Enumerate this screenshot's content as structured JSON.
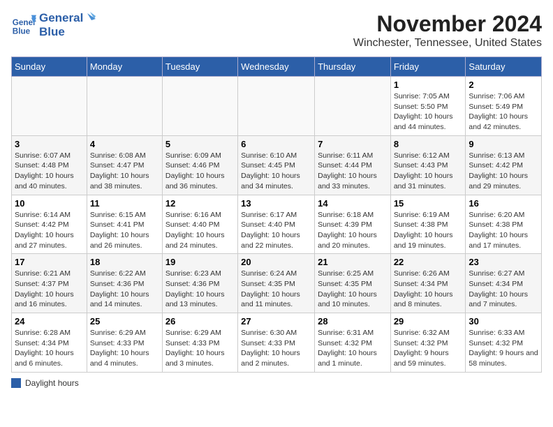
{
  "header": {
    "logo_line1": "General",
    "logo_line2": "Blue",
    "month": "November 2024",
    "location": "Winchester, Tennessee, United States"
  },
  "days_of_week": [
    "Sunday",
    "Monday",
    "Tuesday",
    "Wednesday",
    "Thursday",
    "Friday",
    "Saturday"
  ],
  "weeks": [
    {
      "days": [
        {
          "num": "",
          "info": ""
        },
        {
          "num": "",
          "info": ""
        },
        {
          "num": "",
          "info": ""
        },
        {
          "num": "",
          "info": ""
        },
        {
          "num": "",
          "info": ""
        },
        {
          "num": "1",
          "info": "Sunrise: 7:05 AM\nSunset: 5:50 PM\nDaylight: 10 hours and 44 minutes."
        },
        {
          "num": "2",
          "info": "Sunrise: 7:06 AM\nSunset: 5:49 PM\nDaylight: 10 hours and 42 minutes."
        }
      ]
    },
    {
      "days": [
        {
          "num": "3",
          "info": "Sunrise: 6:07 AM\nSunset: 4:48 PM\nDaylight: 10 hours and 40 minutes."
        },
        {
          "num": "4",
          "info": "Sunrise: 6:08 AM\nSunset: 4:47 PM\nDaylight: 10 hours and 38 minutes."
        },
        {
          "num": "5",
          "info": "Sunrise: 6:09 AM\nSunset: 4:46 PM\nDaylight: 10 hours and 36 minutes."
        },
        {
          "num": "6",
          "info": "Sunrise: 6:10 AM\nSunset: 4:45 PM\nDaylight: 10 hours and 34 minutes."
        },
        {
          "num": "7",
          "info": "Sunrise: 6:11 AM\nSunset: 4:44 PM\nDaylight: 10 hours and 33 minutes."
        },
        {
          "num": "8",
          "info": "Sunrise: 6:12 AM\nSunset: 4:43 PM\nDaylight: 10 hours and 31 minutes."
        },
        {
          "num": "9",
          "info": "Sunrise: 6:13 AM\nSunset: 4:42 PM\nDaylight: 10 hours and 29 minutes."
        }
      ]
    },
    {
      "days": [
        {
          "num": "10",
          "info": "Sunrise: 6:14 AM\nSunset: 4:42 PM\nDaylight: 10 hours and 27 minutes."
        },
        {
          "num": "11",
          "info": "Sunrise: 6:15 AM\nSunset: 4:41 PM\nDaylight: 10 hours and 26 minutes."
        },
        {
          "num": "12",
          "info": "Sunrise: 6:16 AM\nSunset: 4:40 PM\nDaylight: 10 hours and 24 minutes."
        },
        {
          "num": "13",
          "info": "Sunrise: 6:17 AM\nSunset: 4:40 PM\nDaylight: 10 hours and 22 minutes."
        },
        {
          "num": "14",
          "info": "Sunrise: 6:18 AM\nSunset: 4:39 PM\nDaylight: 10 hours and 20 minutes."
        },
        {
          "num": "15",
          "info": "Sunrise: 6:19 AM\nSunset: 4:38 PM\nDaylight: 10 hours and 19 minutes."
        },
        {
          "num": "16",
          "info": "Sunrise: 6:20 AM\nSunset: 4:38 PM\nDaylight: 10 hours and 17 minutes."
        }
      ]
    },
    {
      "days": [
        {
          "num": "17",
          "info": "Sunrise: 6:21 AM\nSunset: 4:37 PM\nDaylight: 10 hours and 16 minutes."
        },
        {
          "num": "18",
          "info": "Sunrise: 6:22 AM\nSunset: 4:36 PM\nDaylight: 10 hours and 14 minutes."
        },
        {
          "num": "19",
          "info": "Sunrise: 6:23 AM\nSunset: 4:36 PM\nDaylight: 10 hours and 13 minutes."
        },
        {
          "num": "20",
          "info": "Sunrise: 6:24 AM\nSunset: 4:35 PM\nDaylight: 10 hours and 11 minutes."
        },
        {
          "num": "21",
          "info": "Sunrise: 6:25 AM\nSunset: 4:35 PM\nDaylight: 10 hours and 10 minutes."
        },
        {
          "num": "22",
          "info": "Sunrise: 6:26 AM\nSunset: 4:34 PM\nDaylight: 10 hours and 8 minutes."
        },
        {
          "num": "23",
          "info": "Sunrise: 6:27 AM\nSunset: 4:34 PM\nDaylight: 10 hours and 7 minutes."
        }
      ]
    },
    {
      "days": [
        {
          "num": "24",
          "info": "Sunrise: 6:28 AM\nSunset: 4:34 PM\nDaylight: 10 hours and 6 minutes."
        },
        {
          "num": "25",
          "info": "Sunrise: 6:29 AM\nSunset: 4:33 PM\nDaylight: 10 hours and 4 minutes."
        },
        {
          "num": "26",
          "info": "Sunrise: 6:29 AM\nSunset: 4:33 PM\nDaylight: 10 hours and 3 minutes."
        },
        {
          "num": "27",
          "info": "Sunrise: 6:30 AM\nSunset: 4:33 PM\nDaylight: 10 hours and 2 minutes."
        },
        {
          "num": "28",
          "info": "Sunrise: 6:31 AM\nSunset: 4:32 PM\nDaylight: 10 hours and 1 minute."
        },
        {
          "num": "29",
          "info": "Sunrise: 6:32 AM\nSunset: 4:32 PM\nDaylight: 9 hours and 59 minutes."
        },
        {
          "num": "30",
          "info": "Sunrise: 6:33 AM\nSunset: 4:32 PM\nDaylight: 9 hours and 58 minutes."
        }
      ]
    }
  ],
  "legend": {
    "label": "Daylight hours"
  }
}
